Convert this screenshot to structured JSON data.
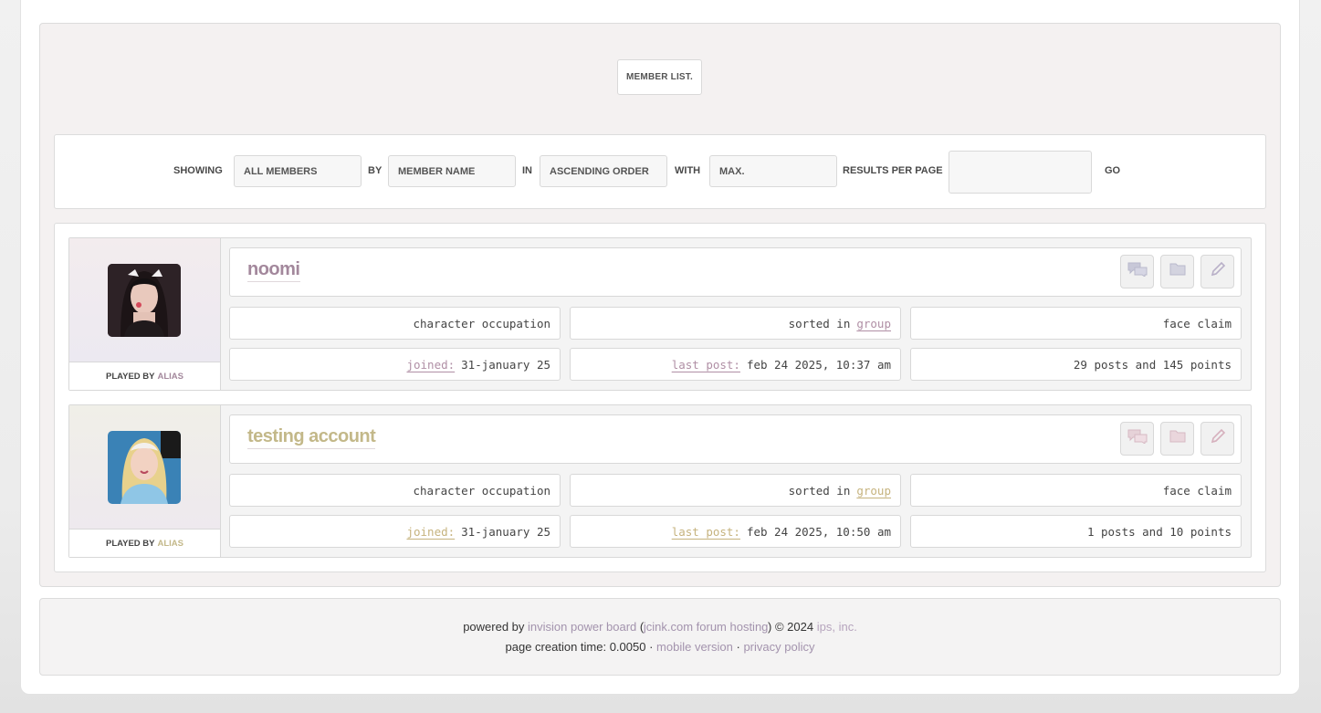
{
  "page": {
    "title": "MEMBER LIST."
  },
  "sort": {
    "showing_label": "SHOWING",
    "showing_value": "ALL MEMBERS",
    "by_label": "BY",
    "by_value": "MEMBER NAME",
    "in_label": "IN",
    "in_value": "ASCENDING ORDER",
    "with_label": "WITH",
    "with_value": "MAX.",
    "results_label": "RESULTS PER PAGE",
    "results_value": "",
    "go_label": "GO"
  },
  "members": [
    {
      "name": "noomi",
      "name_color": "#a3889c",
      "accent_color": "#b08fa5",
      "played_by_label": "PLAYED BY",
      "played_by_value": "ALIAS",
      "occupation": "character occupation",
      "sorted_prefix": "sorted in",
      "sorted_group": "group",
      "face_claim": "face claim",
      "joined_label": "joined:",
      "joined_value": "31-january 25",
      "last_post_label": "last post:",
      "last_post_value": "feb 24 2025, 10:37 am",
      "stats": "29 posts and 145 points",
      "icons": {
        "pm": "speech-bubbles-icon",
        "folder": "folder-icon",
        "edit": "pencil-icon"
      }
    },
    {
      "name": "testing account",
      "name_color": "#c3b889",
      "accent_color": "#c6b37e",
      "played_by_label": "PLAYED BY",
      "played_by_value": "ALIAS",
      "occupation": "character occupation",
      "sorted_prefix": "sorted in",
      "sorted_group": "group",
      "face_claim": "face claim",
      "joined_label": "joined:",
      "joined_value": "31-january 25",
      "last_post_label": "last post:",
      "last_post_value": "feb 24 2025, 10:50 am",
      "stats": "1 posts and 10 points",
      "icons": {
        "pm": "speech-bubbles-icon",
        "folder": "folder-icon",
        "edit": "pencil-icon"
      }
    }
  ],
  "footer": {
    "powered_by": "powered by",
    "ipb_link": "invision power board",
    "open_paren": "(",
    "jcink_link": "jcink.com forum hosting",
    "close_copyright": ") © 2024",
    "ips_link": "ips, inc.",
    "creation_time": "page creation time: 0.0050 ·",
    "mobile_link": "mobile version",
    "separator": "·",
    "privacy_link": "privacy policy"
  },
  "colors": {
    "panel_bg": "#f4f1f1",
    "link": "#a393ad",
    "text": "#444444"
  }
}
